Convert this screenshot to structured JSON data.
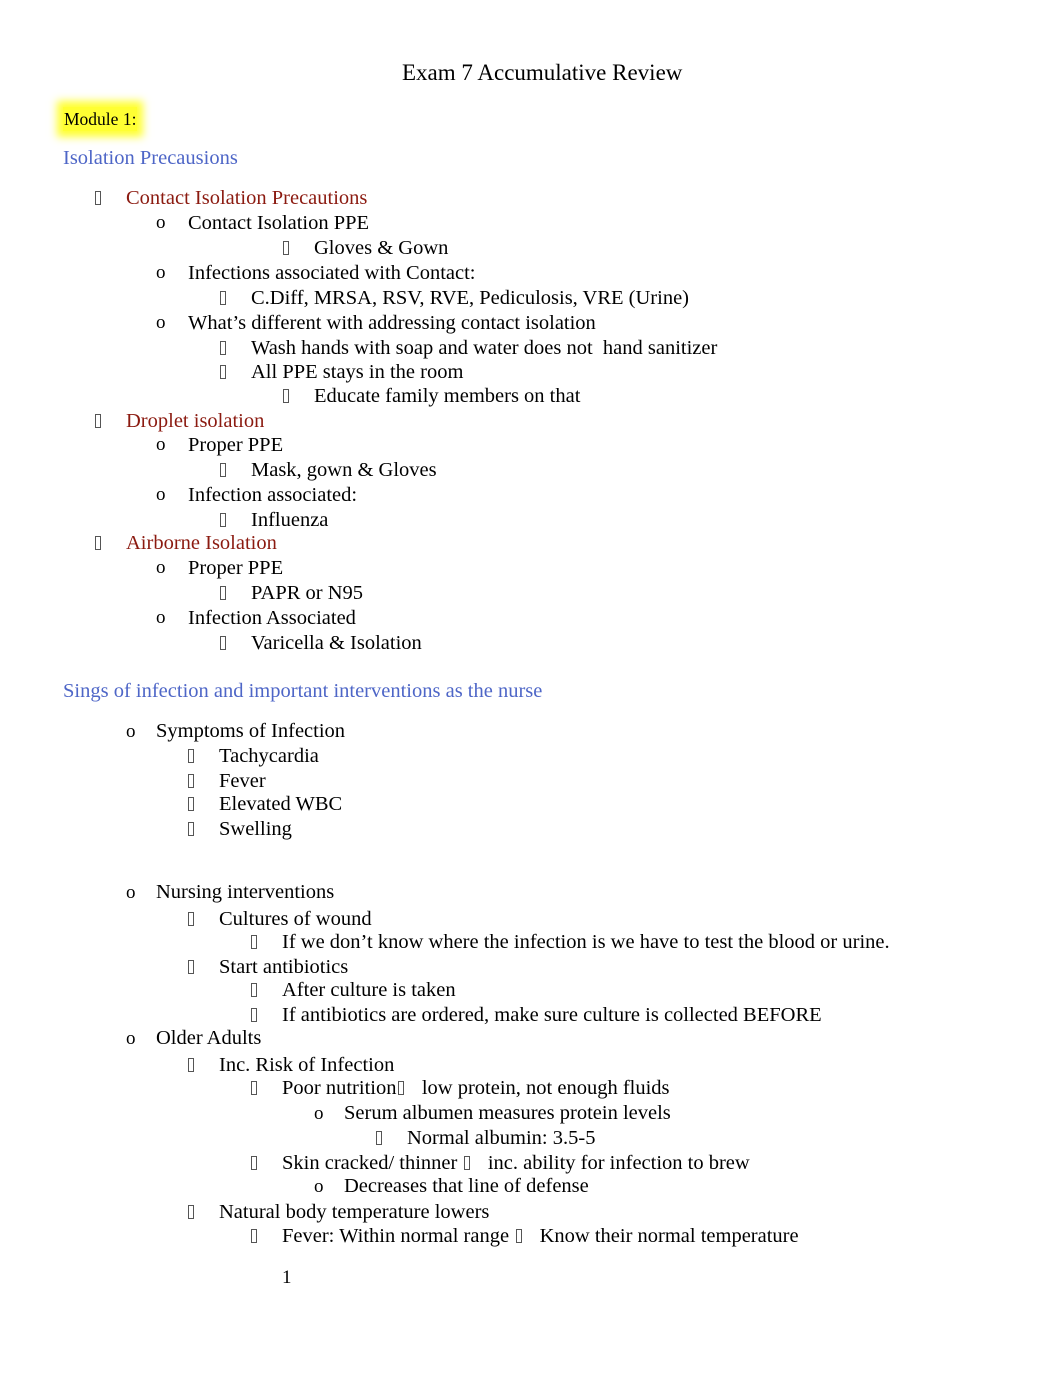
{
  "document": {
    "title": "Exam 7 Accumulative Review",
    "module_label": "Module 1:",
    "page_number": "1",
    "colors": {
      "heading_blue": "#4e66c7",
      "subheading_red": "#8b1a10",
      "highlight_yellow": "#ffff33"
    }
  },
  "sections": [
    {
      "heading": "Isolation Precausions",
      "items": [
        {
          "level": 1,
          "bullet": "tofu",
          "text": "Contact Isolation Precautions",
          "style": "sub-heading"
        },
        {
          "level": 2,
          "bullet": "o",
          "text": "Contact Isolation PPE"
        },
        {
          "level": 4,
          "bullet": "tofu",
          "text": "Gloves & Gown"
        },
        {
          "level": 2,
          "bullet": "o",
          "text": "Infections associated with Contact:"
        },
        {
          "level": 3,
          "bullet": "tofu",
          "text": "C.Diff, MRSA, RSV, RVE, Pediculosis, VRE (Urine)"
        },
        {
          "level": 2,
          "bullet": "o",
          "text": "What’s different with addressing contact isolation"
        },
        {
          "level": 3,
          "bullet": "tofu",
          "text": "Wash hands with soap and water does not  hand sanitizer"
        },
        {
          "level": 3,
          "bullet": "tofu",
          "text": "All PPE stays in the room"
        },
        {
          "level": 4,
          "bullet": "tofu",
          "text": "Educate family members on that"
        },
        {
          "level": 1,
          "bullet": "tofu",
          "text": "Droplet isolation",
          "style": "sub-heading"
        },
        {
          "level": 2,
          "bullet": "o",
          "text": "Proper PPE"
        },
        {
          "level": 3,
          "bullet": "tofu",
          "text": "Mask, gown & Gloves"
        },
        {
          "level": 2,
          "bullet": "o",
          "text": "Infection associated:"
        },
        {
          "level": 3,
          "bullet": "tofu",
          "text": "Influenza"
        },
        {
          "level": 1,
          "bullet": "tofu",
          "text": "Airborne Isolation",
          "style": "sub-heading"
        },
        {
          "level": 2,
          "bullet": "o",
          "text": "Proper PPE"
        },
        {
          "level": 3,
          "bullet": "tofu",
          "text": "PAPR or N95"
        },
        {
          "level": 2,
          "bullet": "o",
          "text": "Infection Associated"
        },
        {
          "level": 3,
          "bullet": "tofu",
          "text": "Varicella & Isolation"
        }
      ]
    },
    {
      "heading": "Sings of infection and important interventions as the nurse",
      "items": [
        {
          "level": 1,
          "bullet": "o",
          "text": "Symptoms of Infection"
        },
        {
          "level": 2,
          "bullet": "tofu",
          "text": "Tachycardia"
        },
        {
          "level": 2,
          "bullet": "tofu",
          "text": "Fever"
        },
        {
          "level": 2,
          "bullet": "tofu",
          "text": "Elevated WBC"
        },
        {
          "level": 2,
          "bullet": "tofu",
          "text": "Swelling"
        },
        {
          "level": 1,
          "bullet": "o",
          "text": "Nursing interventions"
        },
        {
          "level": 2,
          "bullet": "tofu",
          "text": "Cultures of wound"
        },
        {
          "level": 3,
          "bullet": "tofu",
          "text": "If we don’t know where the infection is we have to test the blood or urine."
        },
        {
          "level": 2,
          "bullet": "tofu",
          "text": "Start antibiotics"
        },
        {
          "level": 3,
          "bullet": "tofu",
          "text": "After culture is taken"
        },
        {
          "level": 3,
          "bullet": "tofu",
          "text": "If antibiotics are ordered, make sure culture is collected BEFORE"
        },
        {
          "level": 1,
          "bullet": "o",
          "text": "Older Adults"
        },
        {
          "level": 2,
          "bullet": "tofu",
          "text": "Inc. Risk of Infection"
        },
        {
          "level": 3,
          "bullet": "tofu",
          "text": "Poor nutrition",
          "arrow_text": "low protein, not enough fluids"
        },
        {
          "level": 4,
          "bullet": "o",
          "text": "Serum albumen measures protein levels"
        },
        {
          "level": 5,
          "bullet": "tofu",
          "text": "Normal albumin: 3.5-5"
        },
        {
          "level": 3,
          "bullet": "tofu",
          "text": "Skin cracked/ thinner ",
          "arrow_text": "inc. ability for infection to brew"
        },
        {
          "level": 4,
          "bullet": "o",
          "text": "Decreases that line of defense"
        },
        {
          "level": 2,
          "bullet": "tofu",
          "text": "Natural body temperature lowers"
        },
        {
          "level": 3,
          "bullet": "tofu",
          "text": "Fever: Within normal range ",
          "arrow_text": "Know their normal temperature"
        }
      ]
    }
  ]
}
